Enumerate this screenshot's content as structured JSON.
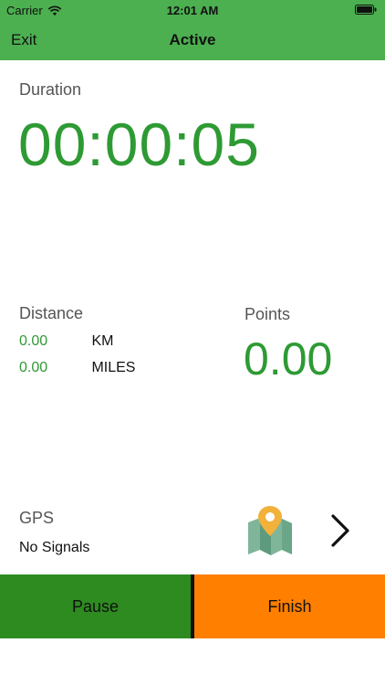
{
  "status_bar": {
    "carrier": "Carrier",
    "time": "12:01 AM",
    "wifi_icon": "wifi-icon",
    "battery_icon": "battery-icon"
  },
  "nav": {
    "exit_label": "Exit",
    "title": "Active"
  },
  "duration": {
    "label": "Duration",
    "value": "00:00:05"
  },
  "distance": {
    "label": "Distance",
    "rows": [
      {
        "value": "0.00",
        "unit": "KM"
      },
      {
        "value": "0.00",
        "unit": "MILES"
      }
    ]
  },
  "points": {
    "label": "Points",
    "value": "0.00"
  },
  "gps": {
    "label": "GPS",
    "status": "No Signals",
    "map_icon": "map-pin-icon",
    "chevron_icon": "chevron-right-icon"
  },
  "actions": {
    "pause_label": "Pause",
    "finish_label": "Finish"
  },
  "colors": {
    "header": "#4caf50",
    "value_green": "#2e9a34",
    "pause": "#2e8b20",
    "finish": "#ff7f00"
  }
}
